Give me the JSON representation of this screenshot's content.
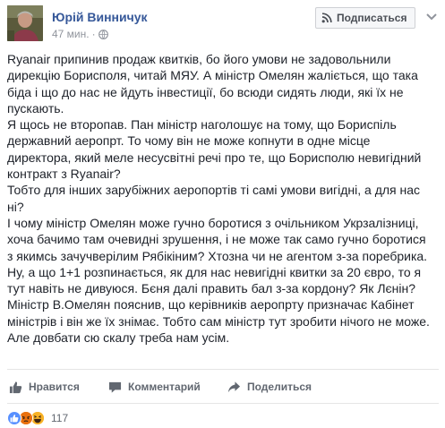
{
  "post": {
    "author": "Юрій Винничук",
    "time": "47 мин.",
    "separator": "·",
    "follow_label": "Подписаться",
    "lines": [
      "Ryanair припинив продаж квитків, бо його умови не задовольнили",
      "дирекцію Борисполя, читай МЯУ. А міністр Омелян жаліється, що така",
      "біда і що до нас не йдуть інвестиції, бо всюди сидять люди, які їх не",
      "пускають.",
      "Я щось не второпав. Пан міністр наголошує на тому, що Бориспіль",
      "державний аеропрт. То чому він не може копнути в одне місце",
      "директора, який меле несусвітні речі про те, що Борисполю невигідний",
      "контракт з Ryanair?",
      "Тобто для інших зарубіжних аеропортів ті самі умови вигідні, а для нас",
      "ні?",
      "І чому міністр Омелян може гучно боротися з очільником Укрзалізниці,",
      "хоча бачимо там очевидні зрушення, і не може так само гучно боротися",
      "з якимсь зачучверілим Рябікіним? Хтозна чи не агентом з-за поребрика.",
      "Ну, а що 1+1 розпинається, як для нас невигідні квитки за 20 євро, то я",
      "тут навіть не дивуюся. Бєня далі править бал з-за кордону? Як Лєнін?",
      "Міністр В.Омелян пояснив, що керівників аеропрту призначає Кабінет",
      "міністрів і він же їх знімає. Тобто сам міністр тут зробити нічого не може.",
      "Але довбати сю скалу треба нам усім."
    ]
  },
  "actions": {
    "like": "Нравится",
    "comment": "Комментарий",
    "share": "Поделиться"
  },
  "reactions": {
    "count": "117",
    "icons": [
      "like-icon",
      "angry-icon",
      "haha-icon"
    ]
  },
  "colors": {
    "link": "#365899",
    "text": "#1d2129",
    "muted": "#90949c",
    "action": "#616770",
    "like_blue": "#5890ff",
    "reaction_yellow": "#f7b125",
    "angry_red": "#e9710f"
  }
}
